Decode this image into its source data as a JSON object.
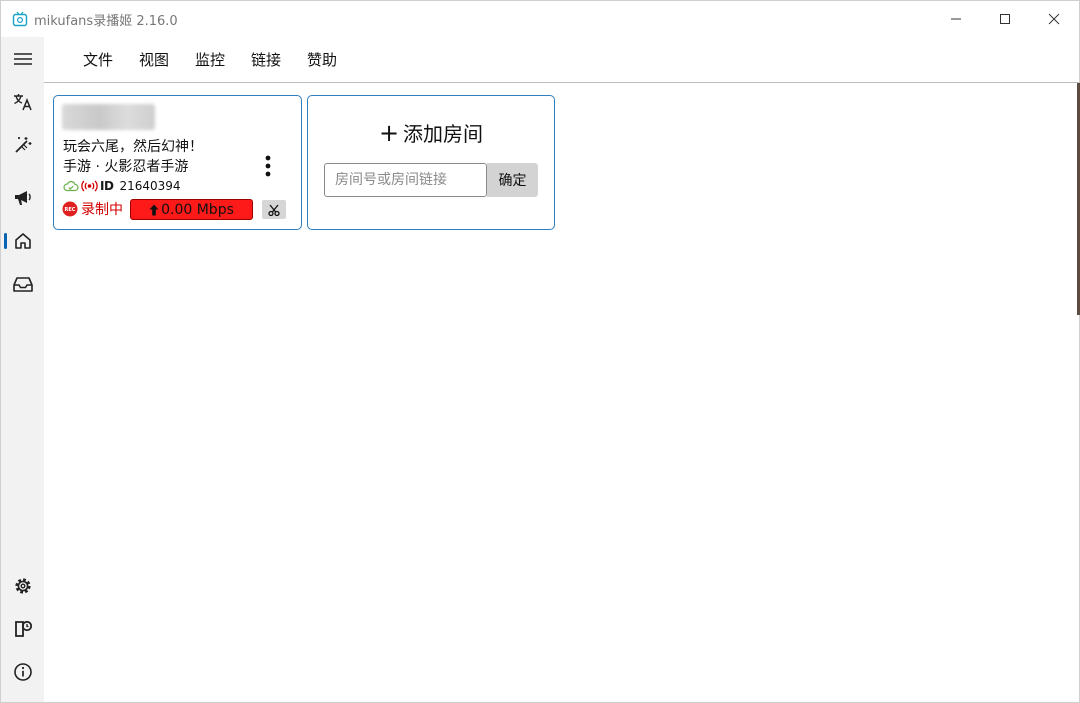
{
  "window": {
    "title": "mikufans录播姬 2.16.0"
  },
  "nav": {
    "items": [
      {
        "icon": "hamburger-menu-icon"
      },
      {
        "icon": "translate-icon"
      },
      {
        "icon": "wand-icon"
      },
      {
        "icon": "megaphone-icon"
      },
      {
        "icon": "home-icon",
        "active": true
      },
      {
        "icon": "inbox-icon"
      },
      {
        "icon": "settings-gear-icon"
      },
      {
        "icon": "log-icon"
      },
      {
        "icon": "info-icon"
      }
    ]
  },
  "menu": {
    "file": "文件",
    "view": "视图",
    "monitor": "监控",
    "link": "链接",
    "sponsor": "赞助"
  },
  "room": {
    "title": "玩会六尾，然后幻神！",
    "area": "手游 · 火影忍者手游",
    "id_label": "ID",
    "room_id": "21640394",
    "rec_badge": "REC",
    "status": "录制中",
    "speed": "0.00 Mbps"
  },
  "add_room": {
    "title": "添加房间",
    "plus": "+",
    "placeholder": "房间号或房间链接",
    "confirm": "确定"
  },
  "colors": {
    "accent": "#2d7fc0",
    "recording": "#d40000",
    "speed_bg": "#ff1a1a"
  }
}
